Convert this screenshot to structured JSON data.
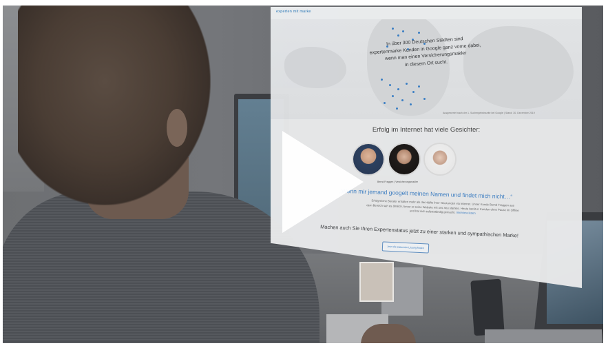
{
  "video": {
    "play_icon": "play-icon"
  },
  "website": {
    "logo_text": "experten mit marke",
    "map_text_line1": "In über 300 Deutschen Städten sind",
    "map_text_line2": "expertenmarke Kunden in Google ganz vorne dabei,",
    "map_text_line3": "wenn man einen Versicherungsmakler",
    "map_text_line4": "in diesem Ort sucht.",
    "map_caption": "Ausgewertet nach der 1. Suchergebnisseite bei Google | Stand: 30. Dezember 2019",
    "heading": "Erfolg im Internet hat viele Gesichter:",
    "person_caption": "Bernd Fraggen | Versicherungsmakler",
    "quote": "„Wenn mir jemand googelt meinen Namen und findet mich nicht…“",
    "body_line1": "Erfolgreiche Berater erhalten mehr als die Hälfte ihrer Neukunden via Internet. Unser Kunde Bernd Fraggen aus",
    "body_line2": "dem Bereich sah es ähnlich, bevor er seine Website mit uns neu startete. Heute berät er Kunden ohne Pause im Offline",
    "body_line3": "und hat sich selbstständig gemacht.",
    "body_link": "Interview lesen",
    "tagline": "Machen auch Sie Ihren Expertenstatus jetzt zu einer starken und sympathischen Marke!",
    "cta_label": "Jetzt die passende Lösung finden"
  },
  "colors": {
    "accent": "#3b7ec4",
    "overlay": "#5b5d61",
    "play": "#ffffff"
  }
}
